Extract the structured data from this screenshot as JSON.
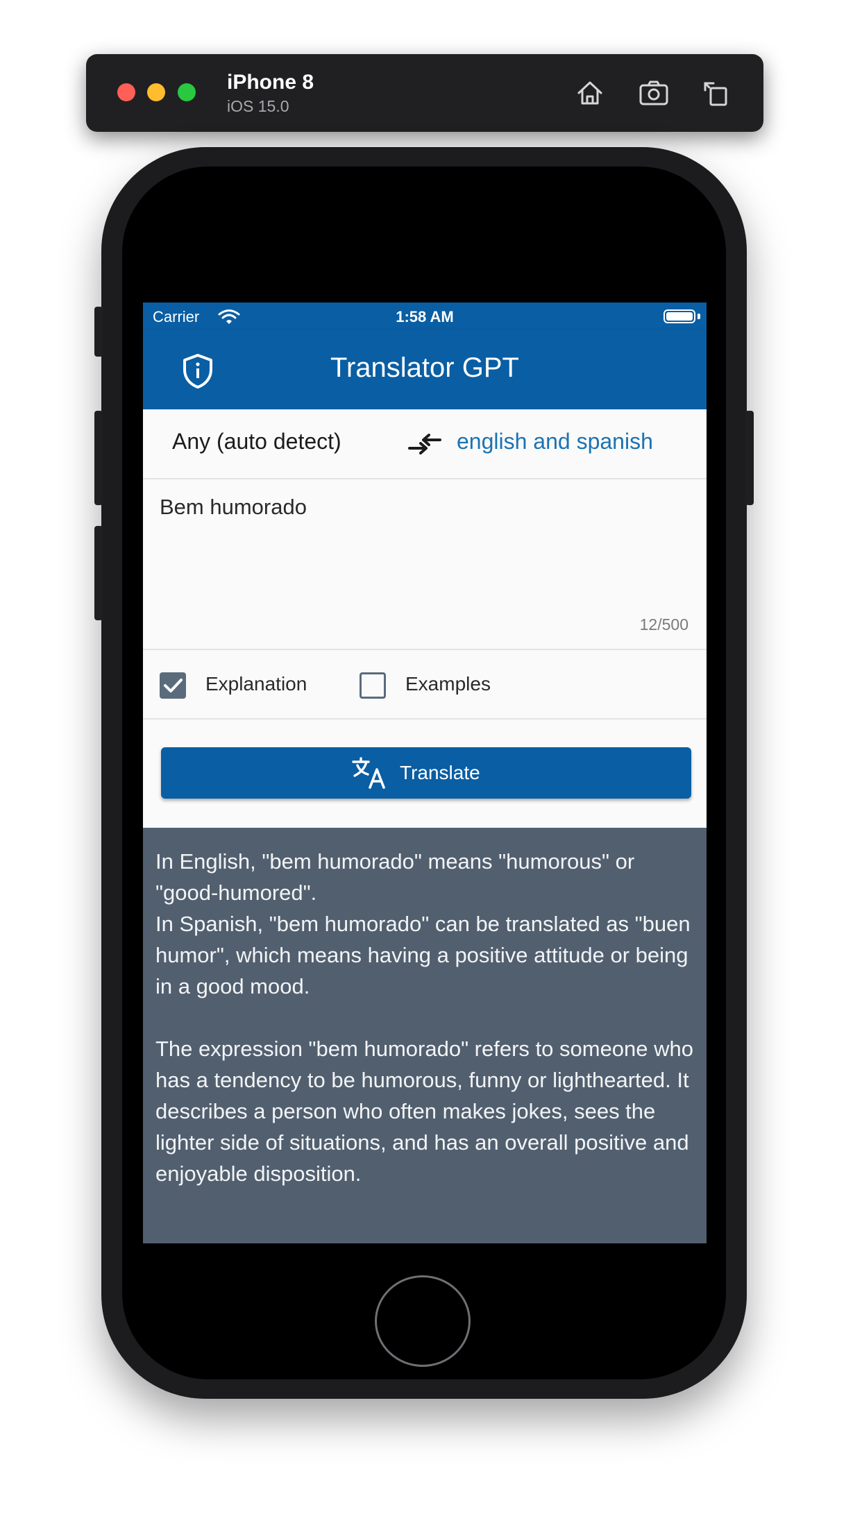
{
  "simulator": {
    "device_name": "iPhone 8",
    "os_version": "iOS 15.0",
    "buttons": [
      "home-icon",
      "screenshot-icon",
      "rotate-icon"
    ]
  },
  "status_bar": {
    "carrier": "Carrier",
    "time": "1:58 AM"
  },
  "app_bar": {
    "title": "Translator GPT",
    "left_icon": "shield-info-icon"
  },
  "languages": {
    "source": "Any (auto detect)",
    "target": "english and spanish",
    "swap_icon": "swap-arrows-icon"
  },
  "input": {
    "text": "Bem humorado",
    "counter": "12/500"
  },
  "options": [
    {
      "label": "Explanation",
      "checked": true
    },
    {
      "label": "Examples",
      "checked": false
    }
  ],
  "translate_button": {
    "label": "Translate",
    "icon": "translate-icon"
  },
  "result": {
    "text": "In English, \"bem humorado\" means \"humorous\" or \"good-humored\".\nIn Spanish, \"bem humorado\" can be translated as \"buen humor\", which means having a positive attitude or being in a good mood.\n\nThe expression \"bem humorado\" refers to someone who has a tendency to be humorous, funny or lighthearted. It describes a person who often makes jokes, sees the lighter side of situations, and has an overall positive and enjoyable disposition."
  },
  "colors": {
    "primary": "#0a5ea3",
    "link": "#1a73b3",
    "result_bg": "#525f6f",
    "checkbox": "#5a6b7c"
  }
}
